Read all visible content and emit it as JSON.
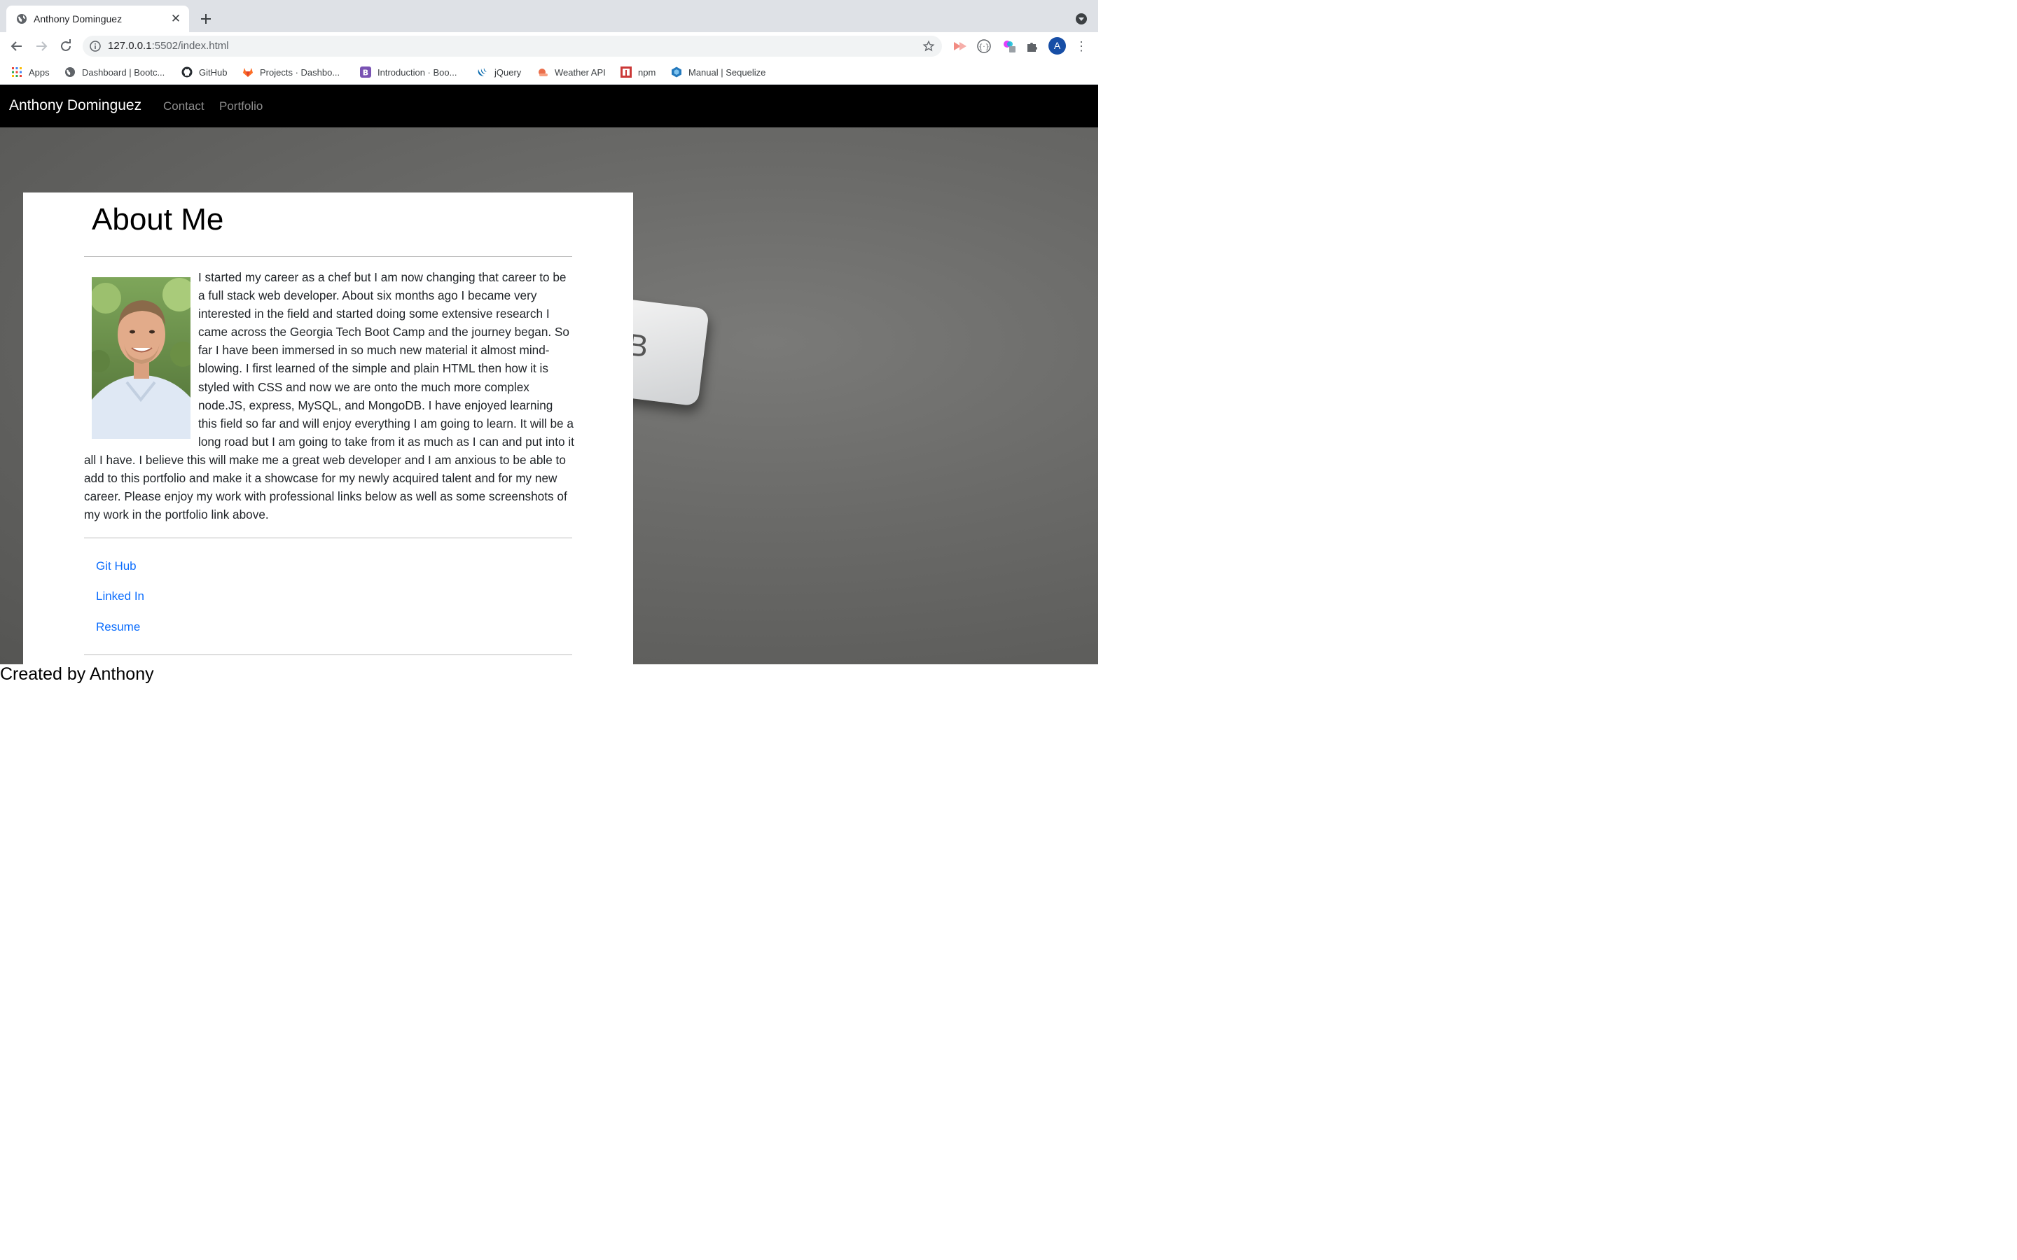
{
  "browser": {
    "tab_title": "Anthony Dominguez",
    "url_host": "127.0.0.1",
    "url_path": ":5502/index.html",
    "avatar_letter": "A",
    "bookmarks": [
      {
        "label": "Apps",
        "icon": "apps-grid-icon"
      },
      {
        "label": "Dashboard | Bootc...",
        "icon": "globe-icon"
      },
      {
        "label": "GitHub",
        "icon": "github-icon"
      },
      {
        "label": "Projects · Dashbo...",
        "icon": "gitlab-icon"
      },
      {
        "label": "Introduction · Boo...",
        "icon": "bootstrap-icon"
      },
      {
        "label": "jQuery",
        "icon": "jquery-icon"
      },
      {
        "label": "Weather API",
        "icon": "weather-icon"
      },
      {
        "label": "npm",
        "icon": "npm-icon"
      },
      {
        "label": "Manual | Sequelize",
        "icon": "sequelize-icon"
      }
    ]
  },
  "navbar": {
    "brand": "Anthony Dominguez",
    "links": [
      "Contact",
      "Portfolio"
    ]
  },
  "about": {
    "heading": "About Me",
    "bio": "I started my career as a chef but I am now changing that career to be a full stack web developer. About six months ago I became very interested in the field and started doing some extensive research I came across the Georgia Tech Boot Camp and the journey began. So far I have been immersed in so much new material it almost mind-blowing. I first learned of the simple and plain HTML then how it is styled with CSS and now we are onto the much more complex node.JS, express, MySQL, and MongoDB. I have enjoyed learning this field so far and will enjoy everything I am going to learn. It will be a long road but I am going to take from it as much as I can and put into it all I have. I believe this will make me a great web developer and I am anxious to be able to add to this portfolio and make it a showcase for my newly acquired talent and for my new career. Please enjoy my work with professional links below as well as some screenshots of my work in the portfolio link above.",
    "links": [
      "Git Hub",
      "Linked In",
      "Resume"
    ]
  },
  "footer": {
    "text": "Created by Anthony"
  },
  "colors": {
    "navbar_bg": "#000000",
    "link": "#0d6efd",
    "chrome_tabstrip": "#dee1e6"
  }
}
